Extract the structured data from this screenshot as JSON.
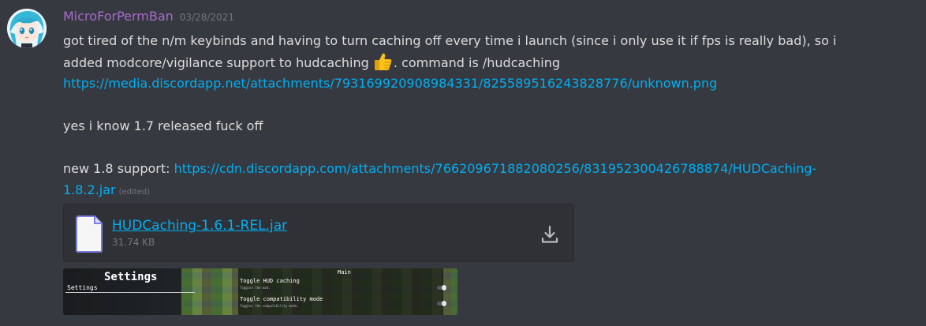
{
  "message": {
    "author": "MicroForPermBan",
    "timestamp": "03/28/2021",
    "author_color": "#a86bd0",
    "line1": "got tired of the n/m keybinds and having to turn caching off every time i launch (since i only use it if fps is really bad), so i",
    "line2_before": "added modcore/vigilance support to hudcaching ",
    "line2_emoji": "thumbs-up-icon",
    "line2_after": ". command is /hudcaching",
    "link1": "https://media.discordapp.net/attachments/793169920908984331/825589516243828776/unknown.png",
    "line3": "yes i know 1.7 released fuck off",
    "line4_prefix": "new 1.8 support: ",
    "link2_part1": "https://cdn.discordapp.com/attachments/766209671882080256/831952300426788874/HUDCaching-",
    "link2_part2": "1.8.2.jar",
    "edited": "(edited)"
  },
  "attachment": {
    "file_name": "HUDCaching-1.6.1-REL.jar",
    "file_size": "31.74 KB",
    "icon": "file-icon",
    "download_icon": "download-icon"
  },
  "preview": {
    "title": "Settings",
    "nav_item": "Settings",
    "category": "Main",
    "option1": "Toggle HUD caching",
    "option1_desc": "Toggles the mod.",
    "option2": "Toggle compatibility mode",
    "option2_desc": "Toggles the compatibility mode."
  },
  "colors": {
    "background": "#36393f",
    "link": "#00aff4",
    "text": "#dcddde",
    "muted": "#72767d"
  }
}
